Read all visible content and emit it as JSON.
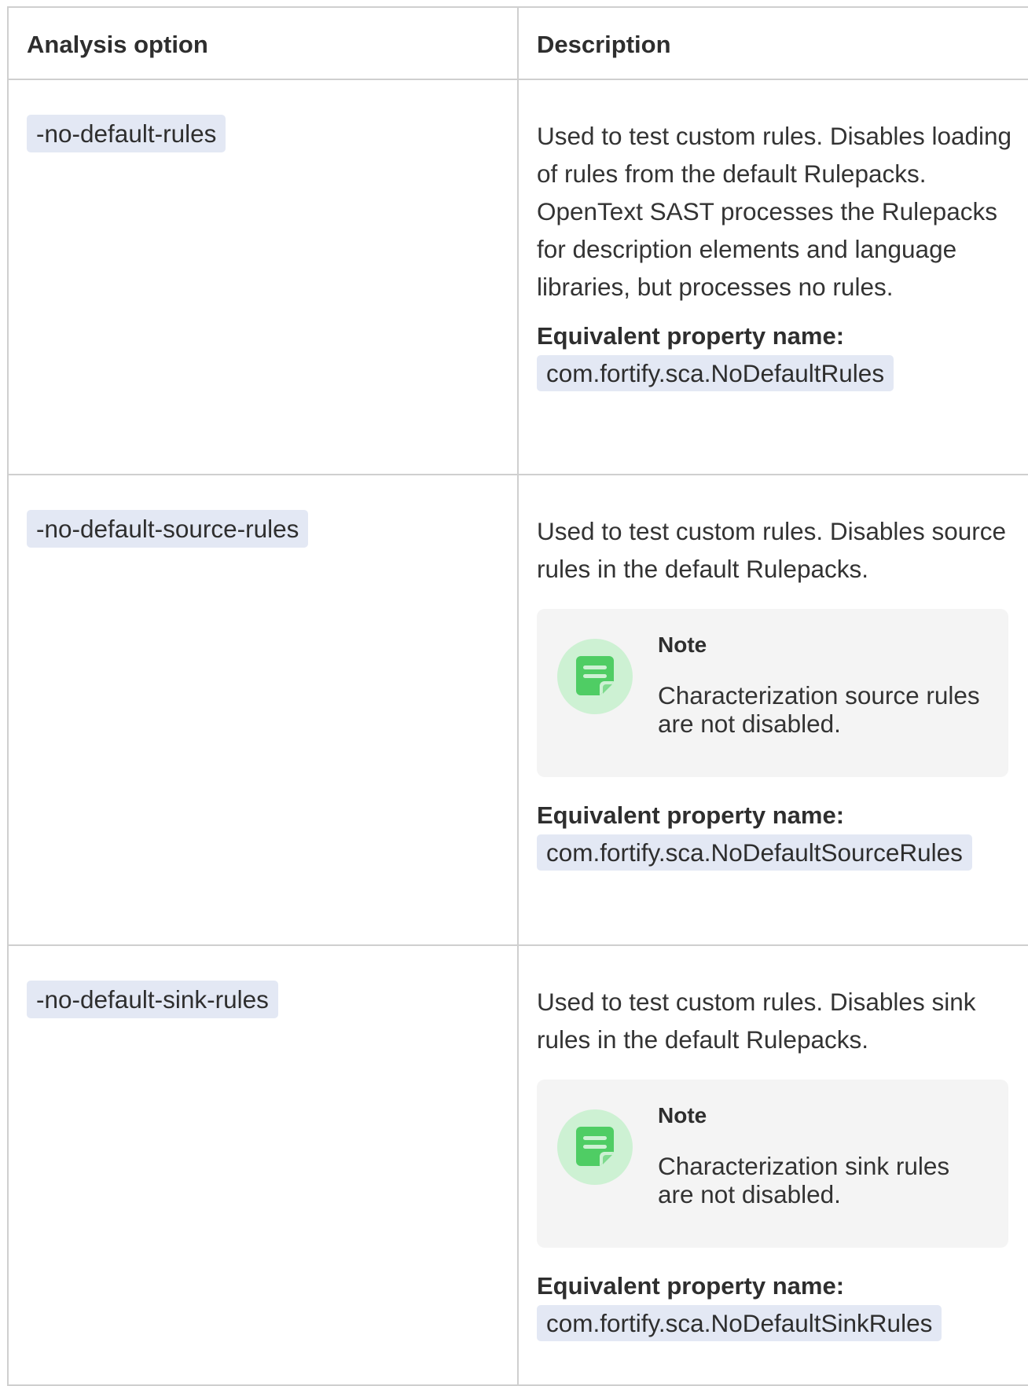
{
  "table": {
    "headers": {
      "option": "Analysis option",
      "description": "Description"
    },
    "rows": [
      {
        "option": "-no-default-rules",
        "description": "Used to test custom rules. Disables loading of rules from the default Rulepacks. OpenText SAST processes the Rulepacks for description elements and language libraries, but processes no rules.",
        "property_label": "Equivalent property name:",
        "property": "com.fortify.sca.NoDefaultRules"
      },
      {
        "option": "-no-default-source-rules",
        "description": "Used to test custom rules. Disables source rules in the default Rulepacks.",
        "note_title": "Note",
        "note_text": "Characterization source rules are not disabled.",
        "property_label": "Equivalent property name:",
        "property": "com.fortify.sca.NoDefaultSourceRules"
      },
      {
        "option": "-no-default-sink-rules",
        "description": "Used to test custom rules. Disables sink rules in the default Rulepacks.",
        "note_title": "Note",
        "note_text": "Characterization sink rules are not disabled.",
        "property_label": "Equivalent property name:",
        "property": "com.fortify.sca.NoDefaultSinkRules"
      }
    ]
  },
  "icons": {
    "note": "note-icon"
  },
  "colors": {
    "code_background": "#e3e8f4",
    "note_background": "#f4f4f4",
    "note_icon_circle": "#cdf1d3",
    "note_icon_fill": "#4fcd64",
    "border": "#cfcfcf"
  }
}
